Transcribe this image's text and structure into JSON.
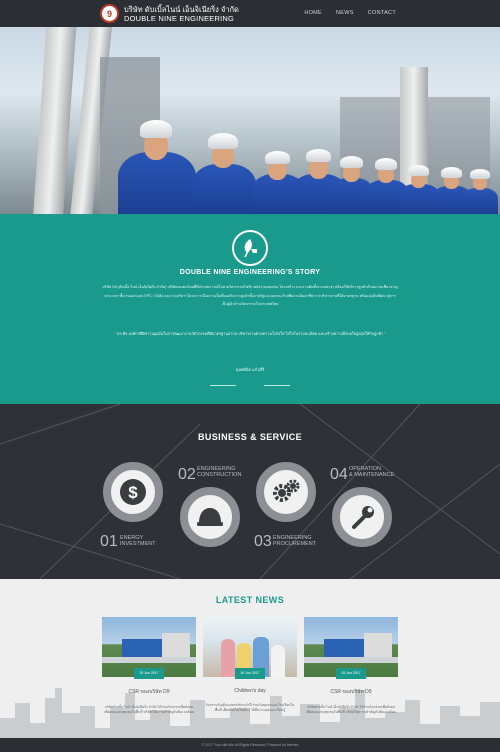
{
  "header": {
    "logo_text": "9",
    "brand_th": "บริษัท ดับเบิ้ลไนน์ เอ็นจิเนียริ่ง จำกัด",
    "brand_en": "DOUBLE NINE ENGINEERING",
    "nav": [
      "HOME",
      "NEWS",
      "CONTACT"
    ]
  },
  "story": {
    "icon": "leaf-plug-icon",
    "title": "DOUBLE NINE ENGINEERING'S STORY",
    "p1": "บริษัท D9 (ดับเบิ้ล ไนน์ เอ็นจิเนียริ่ง จำกัด) บริษัทของคนไทยที่มีประสบการณ์ในสายวิศวกรรมไฟฟ้า พลังงานทดแทน โครงสร้าง และงานติดตั้งระบบต่างๆ พร้อมให้บริการลูกค้าด้วยความเชี่ยวชาญครบวงจร ทั้งงานออกแบบ EPC / O&M และงานบริหารโครงการ มีผลงานเป็นที่ยอมรับจากลูกค้าทั้งภาครัฐและเอกชน ด้วยทีมงานมืออาชีพ การบริหารงานที่ได้มาตรฐาน พร้อมมุ่งมั่นพัฒนาสู่การเป็นผู้นำด้านวิศวกรรมในประเทศไทย",
    "p2": "\" D9 คือ องค์กรที่มีความมุ่งมั่นในการพัฒนางานวิศวกรรมที่มีมาตรฐานสากล บริหารงานด้วยความโปร่งใส ใส่ใจในรายละเอียด และสร้างความพึงพอใจสูงสุดให้กับลูกค้า \"",
    "signature": "ดุลยพินิจ แก้วดีรี"
  },
  "business": {
    "title": "BUSINESS & SERVICE",
    "items": [
      {
        "num": "01",
        "label1": "ENERGY",
        "label2": "INVESTMENT",
        "icon": "dollar-icon"
      },
      {
        "num": "02",
        "label1": "ENGINEERING",
        "label2": "CONSTRUCTION",
        "icon": "helmet-icon"
      },
      {
        "num": "03",
        "label1": "ENGINEERING",
        "label2": "PROCUREMENT",
        "icon": "gears-icon"
      },
      {
        "num": "04",
        "label1": "OPERATION",
        "label2": "& MAINTENANCE",
        "icon": "wrench-icon"
      }
    ]
  },
  "news": {
    "title": "LATEST NEWS",
    "cards": [
      {
        "date": "15 Jun 2017",
        "title": "CSR ของบริษัท D9",
        "desc": "บริษัทดับเบิ้ล ไนน์ เอ็นจิเนียริ่ง จำกัด ได้ร่วมกิจกรรมเพื่อสังคม เพื่อตอบแทนชุมชนในพื้นที่ บริษัทให้ความสำคัญกับสิ่งแวดล้อม"
      },
      {
        "date": "15 Jun 2017",
        "title": "Children's day",
        "desc": "กิจกรรมวันเด็กแห่งชาติประจำปี ร่วมกับชุมชนและโรงเรียนในพื้นที่ เพื่อส่งเสริมให้เด็กๆ ได้มีความสุขและเรียนรู้"
      },
      {
        "date": "15 Jun 2017",
        "title": "CSR ของบริษัท D9",
        "desc": "บริษัทดับเบิ้ล ไนน์ เอ็นจิเนียริ่ง จำกัด ได้ร่วมกิจกรรมเพื่อสังคม เพื่อตอบแทนชุมชนในพื้นที่ บริษัทให้ความสำคัญกับสิ่งแวดล้อม"
      }
    ]
  },
  "footer": {
    "text": "© 2017 Your site title All Rights Reserved. Powered by themes"
  },
  "colors": {
    "accent": "#1a9a8c",
    "dark": "#2f3136",
    "header": "#2b2e33"
  }
}
